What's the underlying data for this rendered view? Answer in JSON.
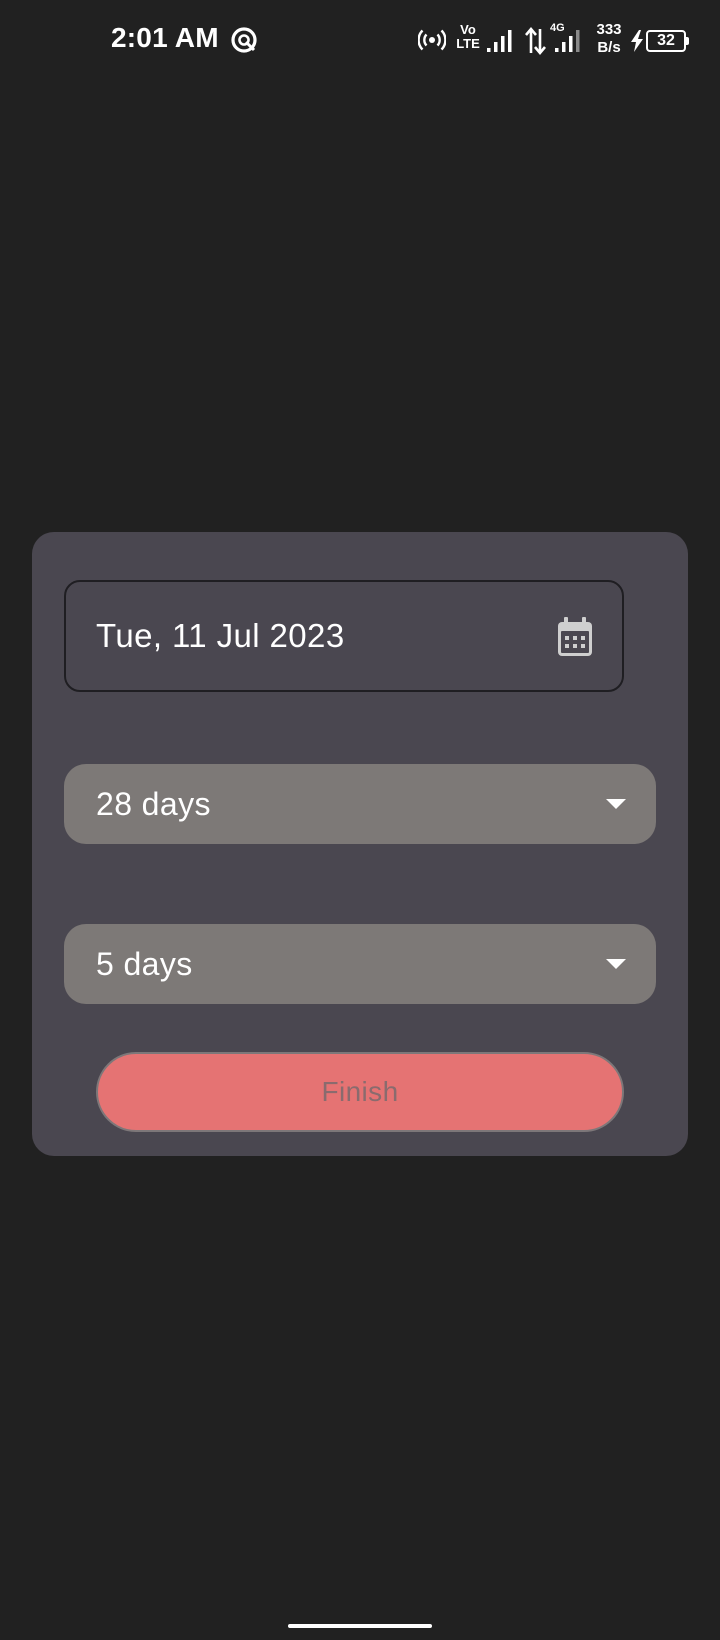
{
  "status_bar": {
    "time": "2:01 AM",
    "volte_top": "Vo",
    "volte_bottom": "LTE",
    "network_type": "4G",
    "speed_value": "333",
    "speed_unit": "B/s",
    "battery_level": "32",
    "icons": [
      "notification-app-icon",
      "hotspot-icon",
      "signal-icon",
      "data-arrows-icon",
      "signal-icon",
      "charging-icon",
      "battery-icon"
    ]
  },
  "form": {
    "date_value": "Tue, 11 Jul 2023",
    "date_icon": "calendar-icon",
    "cycle_length_value": "28 days",
    "period_length_value": "5 days",
    "dropdown_icon": "caret-down-icon",
    "finish_label": "Finish"
  },
  "colors": {
    "background": "#212121",
    "card": "#4a4750",
    "dropdown": "#7d7977",
    "finish_button": "#e57373",
    "finish_text": "#8a6b6e"
  }
}
